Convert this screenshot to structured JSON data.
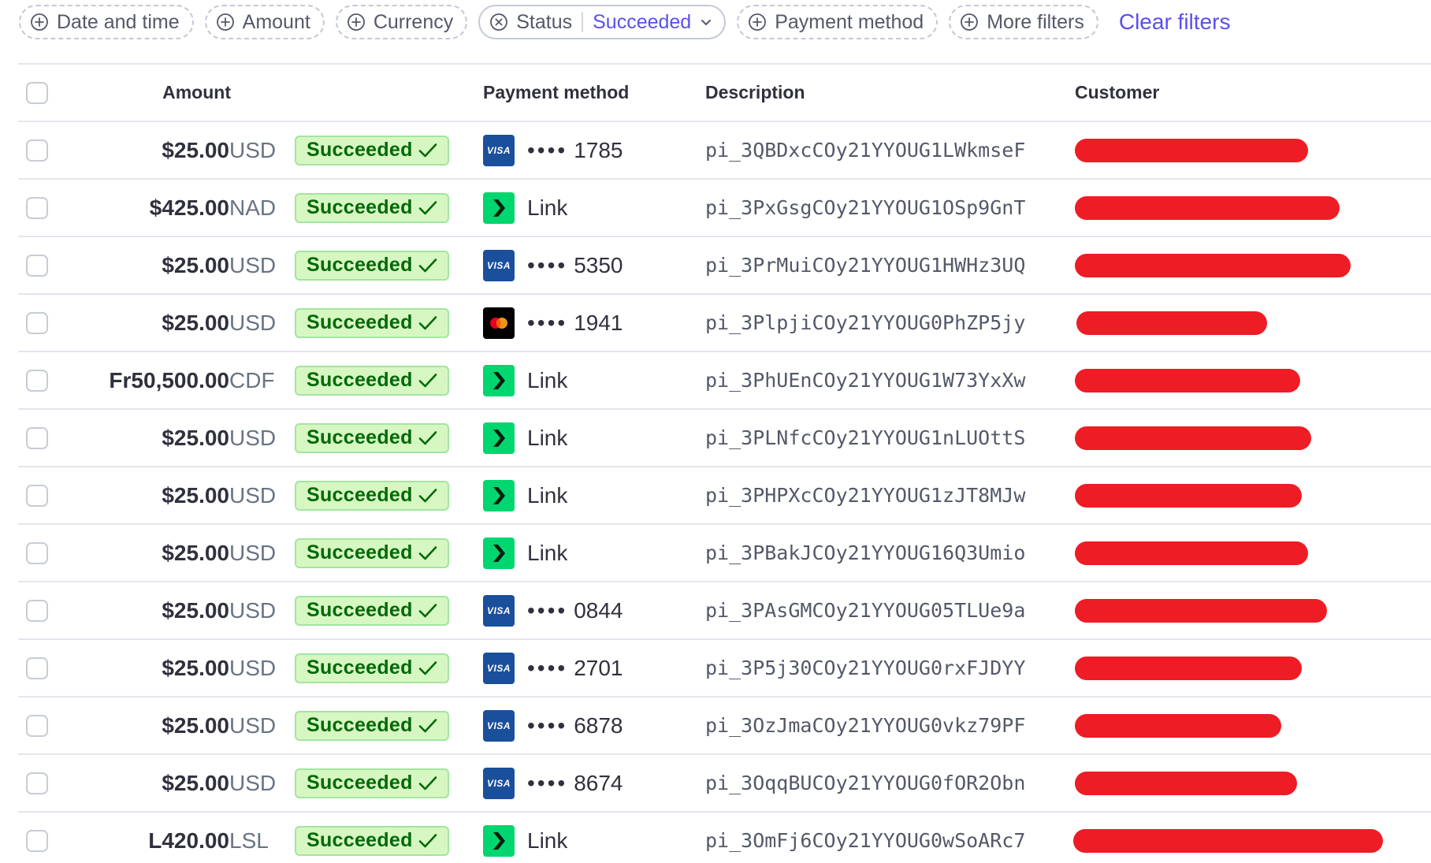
{
  "filters": [
    {
      "label": "Date and time",
      "active": false
    },
    {
      "label": "Amount",
      "active": false
    },
    {
      "label": "Currency",
      "active": false
    },
    {
      "label": "Status",
      "active": true,
      "value": "Succeeded"
    },
    {
      "label": "Payment method",
      "active": false
    },
    {
      "label": "More filters",
      "active": false
    }
  ],
  "clear_filters_label": "Clear filters",
  "columns": {
    "amount": "Amount",
    "payment_method": "Payment method",
    "description": "Description",
    "customer": "Customer"
  },
  "colors": {
    "accent": "#5b4ff0",
    "success_bg": "#d7f7c2",
    "success_text": "#006908",
    "redaction": "#ee1c25",
    "visa": "#1a4f9c",
    "link": "#00d66f"
  },
  "rows": [
    {
      "amount": "$25.00",
      "currency": "USD",
      "status": "Succeeded",
      "pm_type": "visa",
      "pm_label": "1785",
      "description": "pi_3QBDxcCOy21YYOUG1LWkmseF"
    },
    {
      "amount": "$425.00",
      "currency": "NAD",
      "status": "Succeeded",
      "pm_type": "link",
      "pm_label": "Link",
      "description": "pi_3PxGsgCOy21YYOUG1OSp9GnT"
    },
    {
      "amount": "$25.00",
      "currency": "USD",
      "status": "Succeeded",
      "pm_type": "visa",
      "pm_label": "5350",
      "description": "pi_3PrMuiCOy21YYOUG1HWHz3UQ"
    },
    {
      "amount": "$25.00",
      "currency": "USD",
      "status": "Succeeded",
      "pm_type": "mastercard",
      "pm_label": "1941",
      "description": "pi_3PlpjiCOy21YYOUG0PhZP5jy"
    },
    {
      "amount": "Fr50,500.00",
      "currency": "CDF",
      "status": "Succeeded",
      "pm_type": "link",
      "pm_label": "Link",
      "description": "pi_3PhUEnCOy21YYOUG1W73YxXw"
    },
    {
      "amount": "$25.00",
      "currency": "USD",
      "status": "Succeeded",
      "pm_type": "link",
      "pm_label": "Link",
      "description": "pi_3PLNfcCOy21YYOUG1nLUOttS"
    },
    {
      "amount": "$25.00",
      "currency": "USD",
      "status": "Succeeded",
      "pm_type": "link",
      "pm_label": "Link",
      "description": "pi_3PHPXcCOy21YYOUG1zJT8MJw"
    },
    {
      "amount": "$25.00",
      "currency": "USD",
      "status": "Succeeded",
      "pm_type": "link",
      "pm_label": "Link",
      "description": "pi_3PBakJCOy21YYOUG16Q3Umio"
    },
    {
      "amount": "$25.00",
      "currency": "USD",
      "status": "Succeeded",
      "pm_type": "visa",
      "pm_label": "0844",
      "description": "pi_3PAsGMCOy21YYOUG05TLUe9a"
    },
    {
      "amount": "$25.00",
      "currency": "USD",
      "status": "Succeeded",
      "pm_type": "visa",
      "pm_label": "2701",
      "description": "pi_3P5j30COy21YYOUG0rxFJDYY"
    },
    {
      "amount": "$25.00",
      "currency": "USD",
      "status": "Succeeded",
      "pm_type": "visa",
      "pm_label": "6878",
      "description": "pi_3OzJmaCOy21YYOUG0vkz79PF"
    },
    {
      "amount": "$25.00",
      "currency": "USD",
      "status": "Succeeded",
      "pm_type": "visa",
      "pm_label": "8674",
      "description": "pi_3OqqBUCOy21YYOUG0fOR2Obn"
    },
    {
      "amount": "L420.00",
      "currency": "LSL",
      "status": "Succeeded",
      "pm_type": "link",
      "pm_label": "Link",
      "description": "pi_3OmFj6COy21YYOUG0wSoARc7"
    }
  ]
}
